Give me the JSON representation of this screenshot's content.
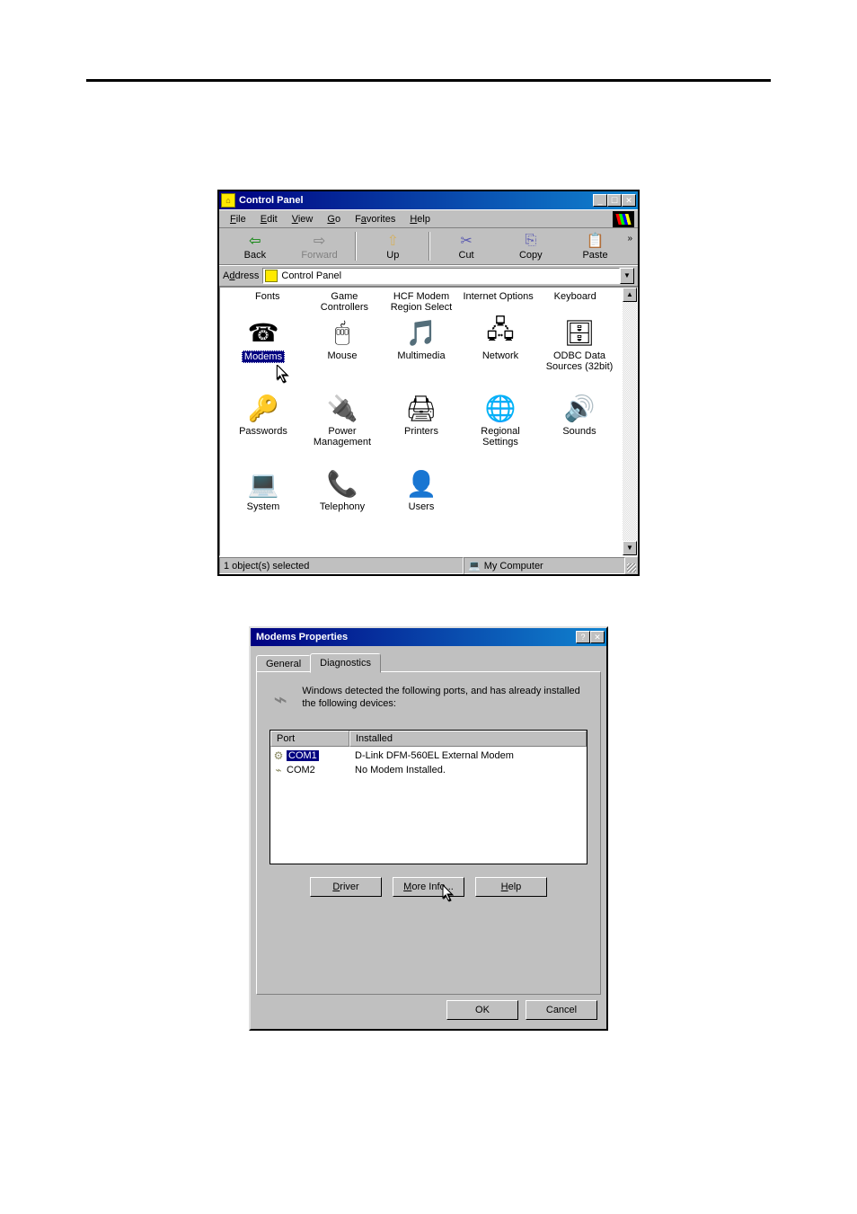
{
  "control_panel": {
    "title": "Control Panel",
    "menus": [
      "File",
      "Edit",
      "View",
      "Go",
      "Favorites",
      "Help"
    ],
    "toolbar": [
      {
        "label": "Back",
        "enabled": true,
        "glyph": "⇦"
      },
      {
        "label": "Forward",
        "enabled": false,
        "glyph": "⇨"
      },
      {
        "label": "Up",
        "enabled": true,
        "glyph": "⇧"
      },
      {
        "label": "Cut",
        "enabled": true,
        "glyph": "✂"
      },
      {
        "label": "Copy",
        "enabled": true,
        "glyph": "⎘"
      },
      {
        "label": "Paste",
        "enabled": true,
        "glyph": "📋"
      }
    ],
    "address_label": "Address",
    "address_value": "Control Panel",
    "top_row": [
      "Fonts",
      "Game Controllers",
      "HCF Modem Region Select",
      "Internet Options",
      "Keyboard"
    ],
    "items": [
      {
        "label": "Modems",
        "glyph": "☎",
        "selected": true
      },
      {
        "label": "Mouse",
        "glyph": "🖱"
      },
      {
        "label": "Multimedia",
        "glyph": "🎵"
      },
      {
        "label": "Network",
        "glyph": "🖧"
      },
      {
        "label": "ODBC Data Sources (32bit)",
        "glyph": "🗄"
      },
      {
        "label": "Passwords",
        "glyph": "🔑"
      },
      {
        "label": "Power Management",
        "glyph": "🔌"
      },
      {
        "label": "Printers",
        "glyph": "🖨"
      },
      {
        "label": "Regional Settings",
        "glyph": "🌐"
      },
      {
        "label": "Sounds",
        "glyph": "🔊"
      },
      {
        "label": "System",
        "glyph": "💻"
      },
      {
        "label": "Telephony",
        "glyph": "📞"
      },
      {
        "label": "Users",
        "glyph": "👤"
      }
    ],
    "status_left": "1 object(s) selected",
    "status_right": "My Computer"
  },
  "modems_dialog": {
    "title": "Modems Properties",
    "tabs": [
      "General",
      "Diagnostics"
    ],
    "active_tab": "Diagnostics",
    "diag_message": "Windows detected the following ports, and has already installed the following devices:",
    "columns": [
      "Port",
      "Installed"
    ],
    "rows": [
      {
        "port": "COM1",
        "installed": "D-Link DFM-560EL External Modem",
        "selected": true
      },
      {
        "port": "COM2",
        "installed": "No Modem Installed.",
        "selected": false
      }
    ],
    "buttons": [
      "Driver",
      "More Info...",
      "Help"
    ],
    "footer_buttons": [
      "OK",
      "Cancel"
    ]
  }
}
